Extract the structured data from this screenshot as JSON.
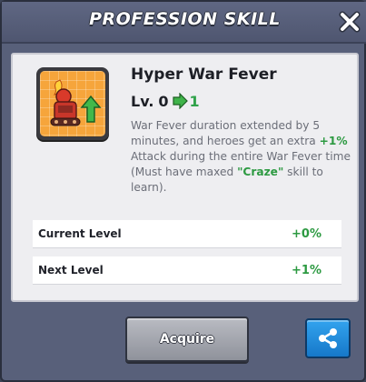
{
  "header": {
    "title": "PROFESSION SKILL",
    "close_icon": "close-icon"
  },
  "skill": {
    "icon": "hyper-war-fever-icon",
    "name": "Hyper War Fever",
    "level_label": "Lv.",
    "current_level": "0",
    "next_level": "1",
    "description": {
      "part1": "War Fever duration extended by 5 minutes, and heroes get an extra ",
      "bonus": "+1%",
      "part2": " Attack during the entire War Fever time (Must have maxed ",
      "required_skill": "\"Craze\"",
      "part3": " skill to learn)."
    }
  },
  "levels": [
    {
      "label": "Current Level",
      "value": "+0%"
    },
    {
      "label": "Next Level",
      "value": "+1%"
    }
  ],
  "footer": {
    "acquire_label": "Acquire",
    "share_icon": "share-icon"
  },
  "colors": {
    "accent_green": "#2d9a42",
    "panel": "#58607a",
    "share_blue": "#1f8ee0"
  }
}
